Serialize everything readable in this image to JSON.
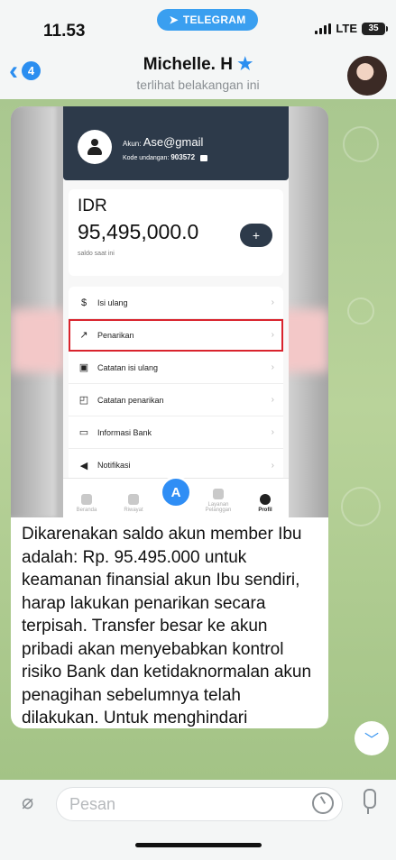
{
  "status": {
    "time": "11.53",
    "network": "LTE",
    "battery": "35",
    "telegram_label": "TELEGRAM"
  },
  "header": {
    "back_count": "4",
    "name": "Michelle. H",
    "star": "★",
    "subtitle": "terlihat belakangan ini"
  },
  "screenshot": {
    "account_label": "Akun:",
    "account_value": "Ase@gmail",
    "invite_label": "Kode undangan:",
    "invite_value": "903572",
    "currency": "IDR",
    "balance": "95,495,000.0",
    "balance_caption": "saldo saat ini",
    "plus": "+",
    "menu": [
      {
        "icon": "dollar-circle-icon",
        "glyph": "$",
        "label": "Isi ulang"
      },
      {
        "icon": "arrow-up-right-icon",
        "glyph": "↗",
        "label": "Penarikan",
        "highlighted": true
      },
      {
        "icon": "topup-record-icon",
        "glyph": "▣",
        "label": "Catatan isi ulang"
      },
      {
        "icon": "withdraw-record-icon",
        "glyph": "◰",
        "label": "Catatan penarikan"
      },
      {
        "icon": "bank-card-icon",
        "glyph": "▭",
        "label": "Informasi Bank"
      },
      {
        "icon": "speaker-icon",
        "glyph": "◀",
        "label": "Notifikasi"
      }
    ],
    "nav": [
      {
        "label": "Beranda"
      },
      {
        "label": "Riwayat"
      },
      {
        "label": ""
      },
      {
        "label": "Layanan Pelanggan"
      },
      {
        "label": "Profil",
        "active": true
      }
    ]
  },
  "message": {
    "text": "Dikarenakan saldo akun member Ibu adalah: Rp. 95.495.000 untuk keamanan finansial akun Ibu sendiri, harap lakukan penarikan secara terpisah. Transfer besar ke akun pribadi akan menyebabkan kontrol risiko Bank dan ketidaknormalan akun penagihan sebelumnya telah dilakukan. Untuk menghindari kesalahan transfer silahkan lakukan penarikan dengan instruksi berikut dibawah ini :"
  },
  "composer": {
    "placeholder": "Pesan"
  },
  "colors": {
    "accent": "#2b8ef0",
    "chat_bg": "#b0cc93",
    "highlight": "#d9232d"
  }
}
